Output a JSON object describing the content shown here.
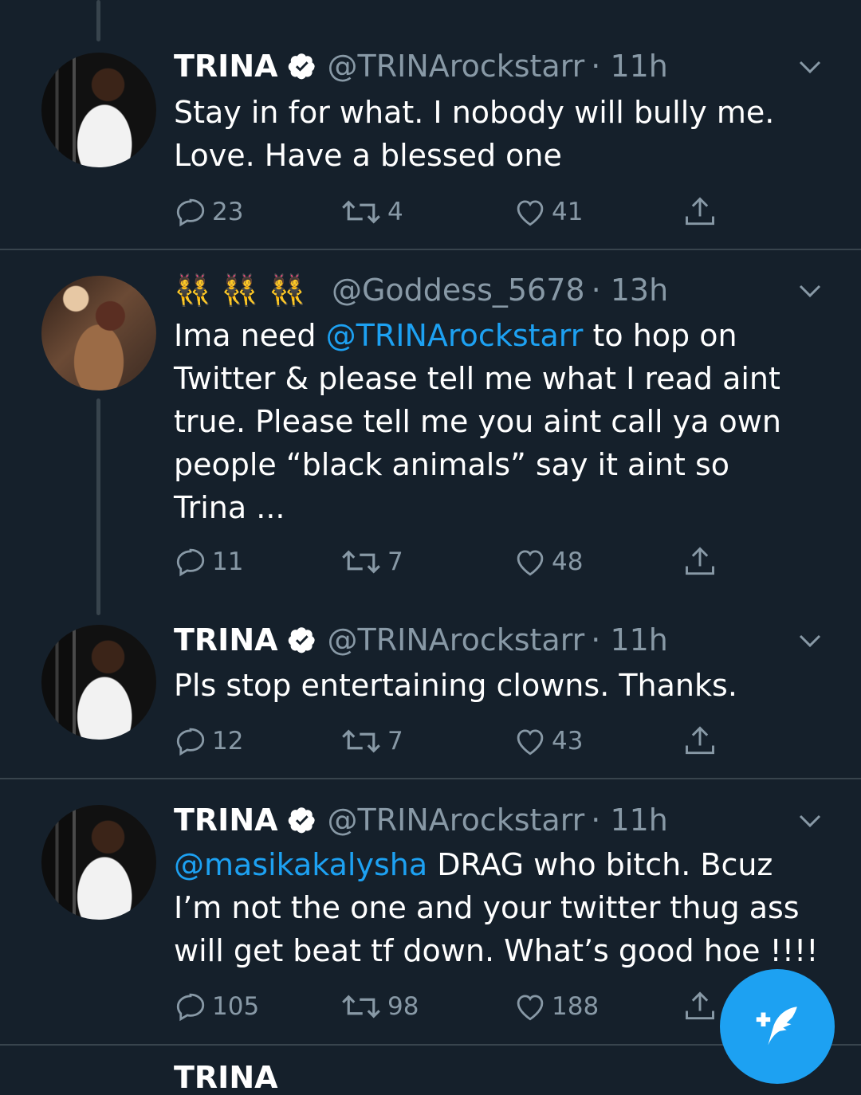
{
  "tweets": [
    {
      "name": "TRINA",
      "handle": "@TRINArockstarr",
      "time": "· 11h",
      "text": "Stay in for what. I nobody will bully me.\nLove. Have a blessed one",
      "replies": "23",
      "retweets": "4",
      "likes": "41"
    },
    {
      "emoji": "👯👯👯",
      "handle": "@Goddess_5678",
      "time": "· 13h",
      "text_parts": [
        "Ima need ",
        "@TRINArockstarr",
        " to hop on\nTwitter & please tell me what I read aint\ntrue. Please tell me you aint call ya own\npeople “black animals” say it aint so\nTrina ..."
      ],
      "replies": "11",
      "retweets": "7",
      "likes": "48"
    },
    {
      "name": "TRINA",
      "handle": "@TRINArockstarr",
      "time": "· 11h",
      "text": "Pls stop entertaining clowns. Thanks.",
      "replies": "12",
      "retweets": "7",
      "likes": "43"
    },
    {
      "name": "TRINA",
      "handle": "@TRINArockstarr",
      "time": "· 11h",
      "text_parts": [
        "@masikakalysha",
        " DRAG who bitch. Bcuz\nI’m not the one and your twitter thug ass\nwill get beat tf down. What’s good hoe !!!!"
      ],
      "replies": "105",
      "retweets": "98",
      "likes": "188"
    }
  ],
  "partial_next": {
    "name": "TRINA"
  },
  "icons": {
    "reply": "reply-icon",
    "retweet": "retweet-icon",
    "like": "heart-icon",
    "share": "share-icon",
    "verified": "verified-badge-icon",
    "more": "chevron-down-icon",
    "compose": "compose-tweet-icon"
  },
  "colors": {
    "background": "#15202b",
    "accent": "#1da1f2",
    "muted": "#8899a6",
    "divider": "#38444d"
  }
}
